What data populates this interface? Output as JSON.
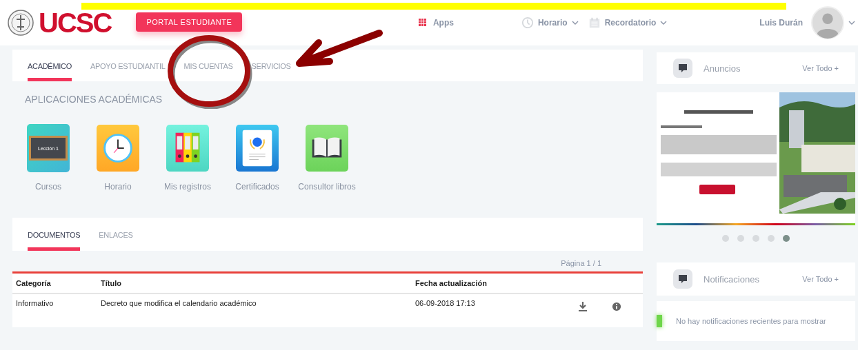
{
  "header": {
    "logo": "UCSC",
    "portal_button": "PORTAL ESTUDIANTE",
    "apps": "Apps",
    "menus": [
      {
        "label": "Horario",
        "kind": "clock"
      },
      {
        "label": "Recordatorio",
        "kind": "calendar"
      }
    ],
    "user": "Luis Durán"
  },
  "tabs": [
    {
      "label": "ACADÉMICO",
      "selected": true
    },
    {
      "label": "APOYO ESTUDIANTIL",
      "selected": false
    },
    {
      "label": "MIS CUENTAS",
      "selected": false
    },
    {
      "label": "SERVICIOS",
      "selected": false
    }
  ],
  "apps_section": {
    "title": "APLICACIONES ACADÉMICAS",
    "apps": [
      {
        "label": "Cursos",
        "kind": "chalkboard",
        "board_text": "Lección 1"
      },
      {
        "label": "Horario",
        "kind": "clock"
      },
      {
        "label": "Mis registros",
        "kind": "binders"
      },
      {
        "label": "Certificados",
        "kind": "certificate"
      },
      {
        "label": "Consultor libros",
        "kind": "book"
      }
    ]
  },
  "doc_tabs": [
    {
      "label": "DOCUMENTOS",
      "selected": true
    },
    {
      "label": "ENLACES",
      "selected": false
    }
  ],
  "pagination": "Página 1 / 1",
  "table": {
    "columns": [
      "Categoría",
      "Título",
      "Fecha actualización"
    ],
    "rows": [
      {
        "cells": [
          "Informativo",
          "Decreto que modifica el calendario académico",
          "06-09-2018 17:13"
        ]
      }
    ]
  },
  "announcements": {
    "title": "Anuncios",
    "view_all": "Ver Todo +",
    "dots": [
      {
        "selected": false
      },
      {
        "selected": false
      },
      {
        "selected": false
      },
      {
        "selected": false
      },
      {
        "selected": true
      }
    ]
  },
  "notifications": {
    "title": "Notificaciones",
    "view_all": "Ver Todo +",
    "empty": "No hay notificaciones recientes para mostrar"
  }
}
